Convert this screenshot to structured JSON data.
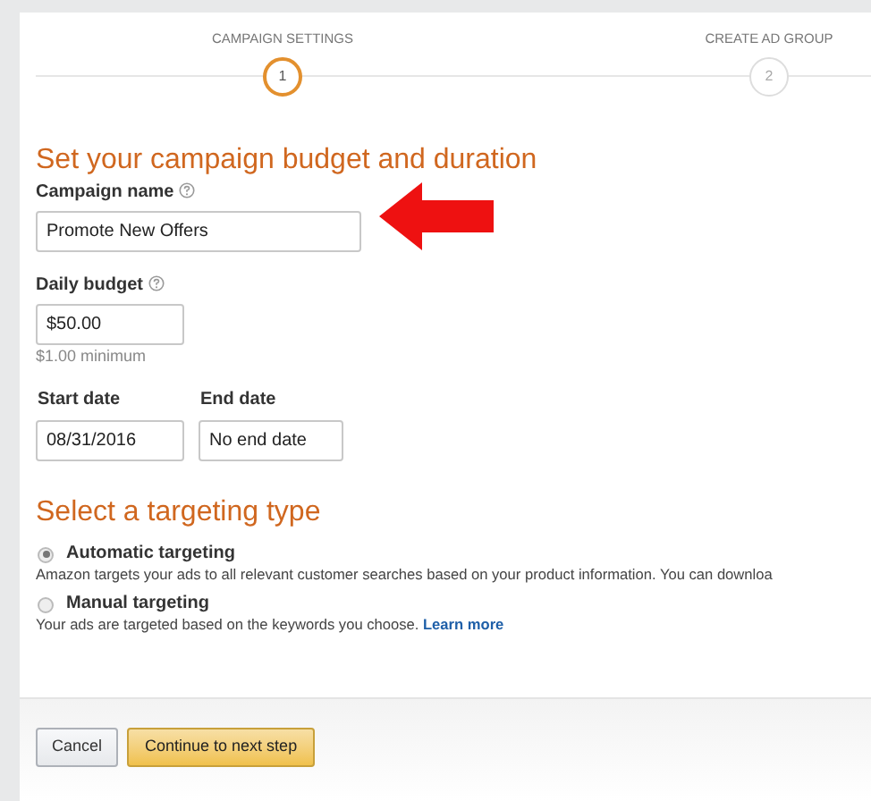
{
  "steps": [
    {
      "label": "CAMPAIGN SETTINGS",
      "number": "1",
      "selected": true
    },
    {
      "label": "CREATE AD GROUP",
      "number": "2",
      "selected": false
    }
  ],
  "budget_section": {
    "title": "Set your campaign budget and duration",
    "campaign_name": {
      "label": "Campaign name",
      "value": "Promote New Offers"
    },
    "daily_budget": {
      "label": "Daily budget",
      "value": "$50.00",
      "hint": "$1.00 minimum"
    },
    "start_date": {
      "label": "Start date",
      "value": "08/31/2016"
    },
    "end_date": {
      "label": "End date",
      "value": "No end date"
    }
  },
  "targeting_section": {
    "title": "Select a targeting type",
    "options": [
      {
        "label": "Automatic targeting",
        "description": "Amazon targets your ads to all relevant customer searches based on your product information. You can downloa",
        "selected": true
      },
      {
        "label": "Manual targeting",
        "description": "Your ads are targeted based on the keywords you choose.",
        "link": "Learn more",
        "selected": false
      }
    ]
  },
  "buttons": [
    {
      "label": "Cancel",
      "kind": "secondary"
    },
    {
      "label": "Continue to next step",
      "kind": "primary"
    }
  ]
}
